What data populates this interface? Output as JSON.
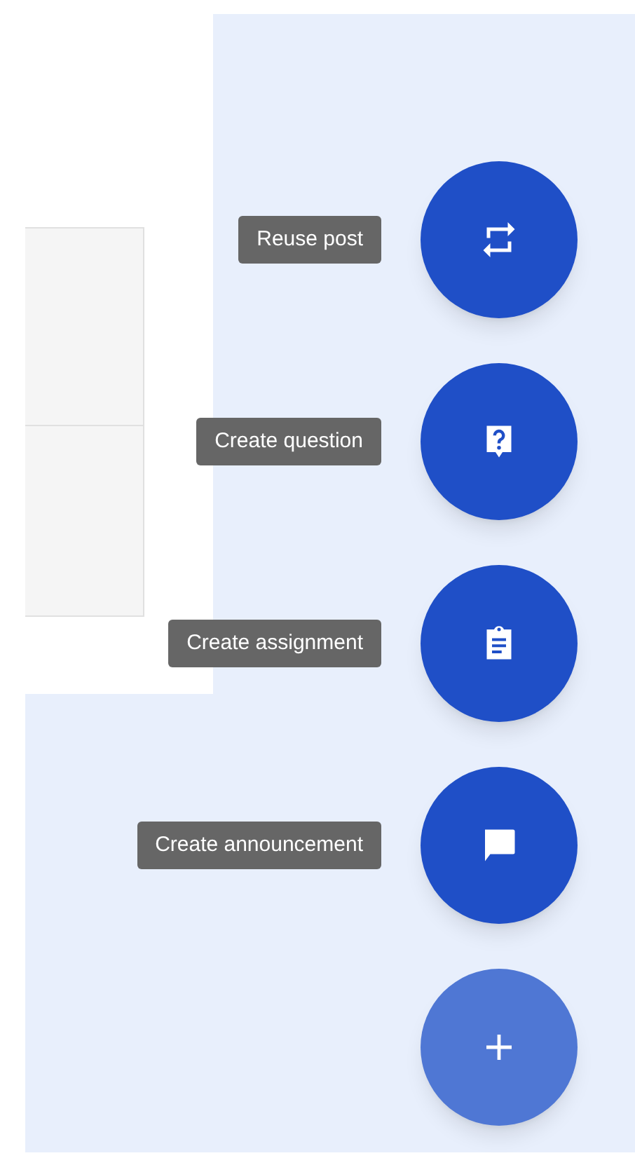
{
  "speed_dial": {
    "actions": [
      {
        "label": "Reuse post",
        "kind": "repost"
      },
      {
        "label": "Create question",
        "kind": "question"
      },
      {
        "label": "Create assignment",
        "kind": "assignment"
      },
      {
        "label": "Create announcement",
        "kind": "announcement"
      }
    ],
    "expanded": true
  }
}
